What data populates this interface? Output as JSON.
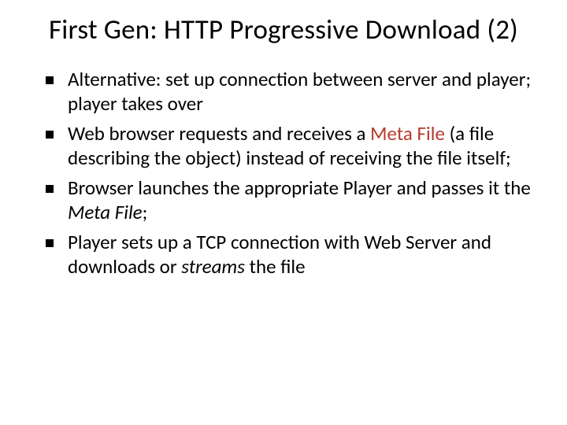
{
  "title": "First Gen: HTTP  Progressive Download (2)",
  "bullets": {
    "b1": "Alternative: set up connection between server and player; player takes over",
    "b2_pre": "Web browser requests and receives a ",
    "b2_meta": "Meta File",
    "b2_post": " (a file describing the object) instead of receiving the file itself;",
    "b3_pre": "Browser launches the appropriate Player and passes it the ",
    "b3_meta": "Meta File",
    "b3_post": ";",
    "b4_pre": "Player sets up a TCP connection with Web Server and downloads or ",
    "b4_streams": "streams",
    "b4_post": " the file"
  }
}
